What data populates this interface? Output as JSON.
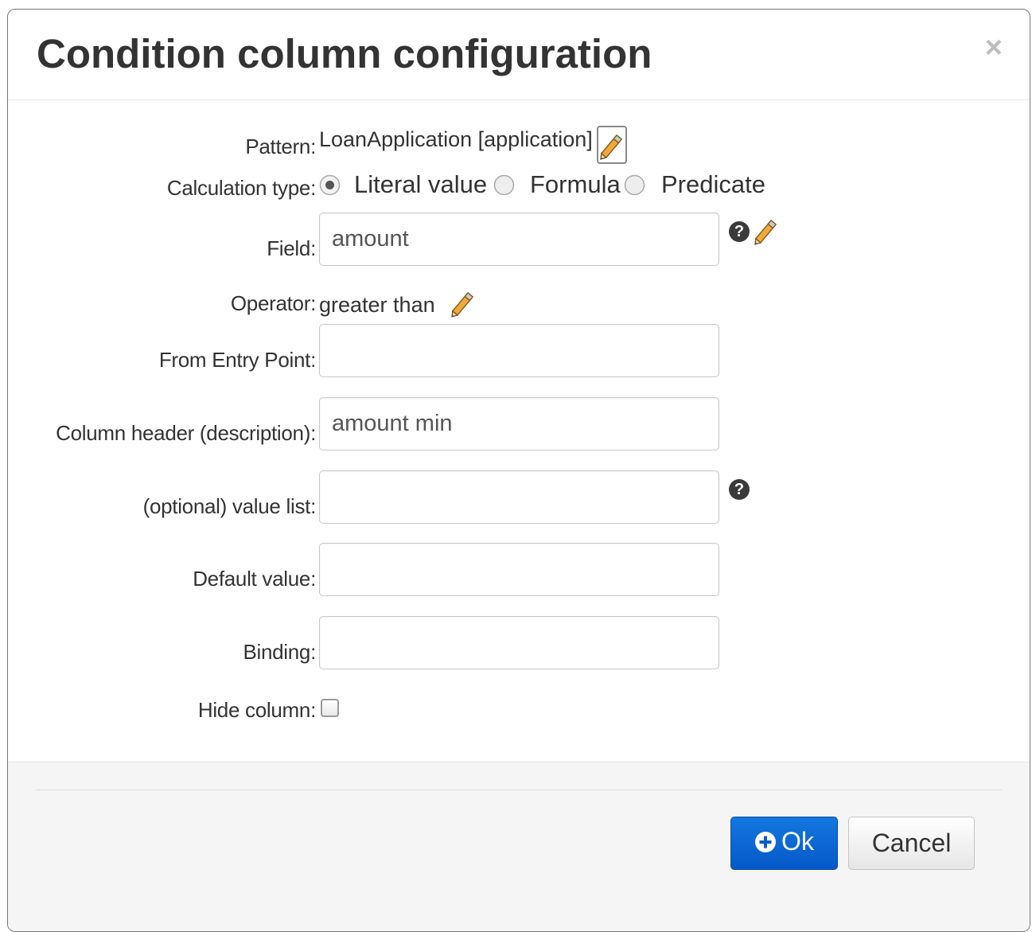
{
  "dialog": {
    "title": "Condition column configuration",
    "close_glyph": "×"
  },
  "form": {
    "pattern": {
      "label": "Pattern:",
      "value": "LoanApplication [application]",
      "edit_icon": "pencil-icon"
    },
    "calculation_type": {
      "label": "Calculation type:",
      "options": [
        "Literal value",
        "Formula",
        "Predicate"
      ],
      "selected": "Literal value"
    },
    "field": {
      "label": "Field:",
      "value": "amount",
      "help_icon": "question-circle-icon",
      "edit_icon": "pencil-icon"
    },
    "operator": {
      "label": "Operator:",
      "value": "greater than",
      "edit_icon": "pencil-icon"
    },
    "from_entry_point": {
      "label": "From Entry Point:",
      "value": ""
    },
    "column_header": {
      "label": "Column header (description):",
      "value": "amount min"
    },
    "value_list": {
      "label": "(optional) value list:",
      "value": "",
      "help_icon": "question-circle-icon"
    },
    "default_value": {
      "label": "Default value:",
      "value": ""
    },
    "binding": {
      "label": "Binding:",
      "value": ""
    },
    "hide_column": {
      "label": "Hide column:",
      "checked": false
    }
  },
  "footer": {
    "ok_label": "Ok",
    "ok_icon": "plus-circle-icon",
    "cancel_label": "Cancel"
  },
  "colors": {
    "primary": "#0459c9",
    "pencil": "#e8a23a"
  }
}
